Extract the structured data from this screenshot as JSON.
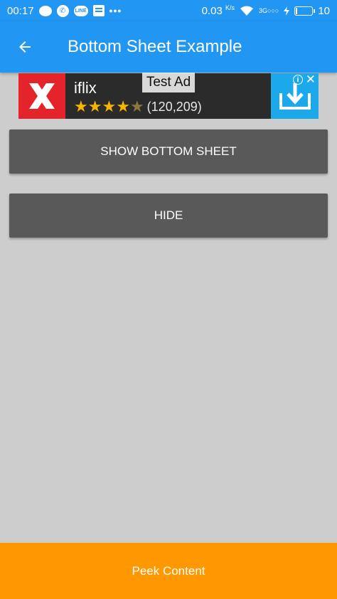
{
  "status_bar": {
    "time": "00:17",
    "speed_value": "0.03",
    "speed_unit": "K/s",
    "network_type": "3G",
    "battery_level": "10",
    "battery_fraction": 0.1,
    "dots": "•••",
    "line_app_label": "LINE"
  },
  "app_bar": {
    "title": "Bottom Sheet Example",
    "back_icon": "arrow-left-icon"
  },
  "ad": {
    "app_name": "iflix",
    "label": "Test Ad",
    "rating_count": "(120,209)",
    "stars_filled": 4,
    "stars_total": 5,
    "logo_letter": "X",
    "info_symbol": "i",
    "close_symbol": "✕"
  },
  "buttons": {
    "show_label": "SHOW BOTTOM SHEET",
    "hide_label": "HIDE"
  },
  "bottom_sheet": {
    "peek_label": "Peek Content"
  },
  "colors": {
    "primary": "#2196f3",
    "background": "#cdcdcd",
    "button": "#595959",
    "peek": "#ff9800",
    "ad_logo": "#e5232a",
    "ad_download": "#1ba9ec"
  }
}
